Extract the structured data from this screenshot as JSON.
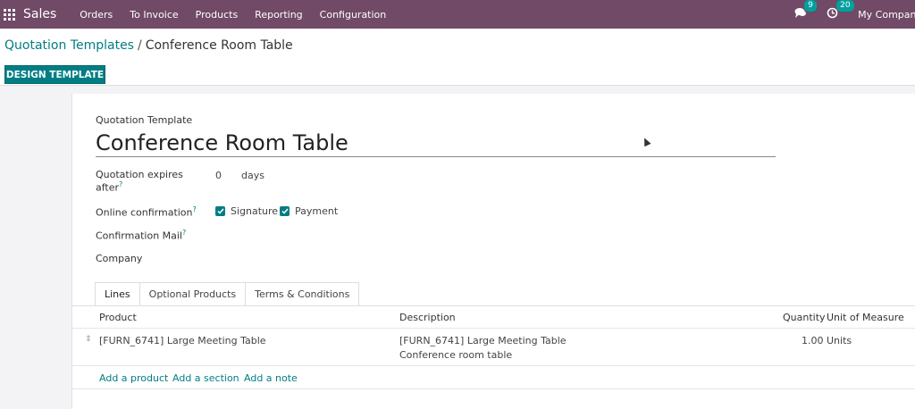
{
  "navbar": {
    "app_name": "Sales",
    "menu": [
      "Orders",
      "To Invoice",
      "Products",
      "Reporting",
      "Configuration"
    ],
    "messages_count": "9",
    "activities_count": "20",
    "company": "My Company"
  },
  "breadcrumb": {
    "parent": "Quotation Templates",
    "separator": "/",
    "current": "Conference Room Table"
  },
  "actions": {
    "design_template": "DESIGN TEMPLATE"
  },
  "form": {
    "section_label": "Quotation Template",
    "name": "Conference Room Table",
    "expires_label_line1": "Quotation expires",
    "expires_label_line2": "after",
    "expires_value": "0",
    "expires_unit": "days",
    "online_confirmation_label": "Online confirmation",
    "signature_label": "Signature",
    "payment_label": "Payment",
    "confirmation_mail_label": "Confirmation Mail",
    "company_label": "Company",
    "help_mark": "?"
  },
  "tabs": [
    "Lines",
    "Optional Products",
    "Terms & Conditions"
  ],
  "table": {
    "headers": {
      "product": "Product",
      "description": "Description",
      "quantity": "Quantity",
      "uom": "Unit of Measure"
    },
    "rows": [
      {
        "product": "[FURN_6741] Large Meeting Table",
        "description_line1": "[FURN_6741] Large Meeting Table",
        "description_line2": "Conference room table",
        "quantity": "1.00",
        "uom": "Units"
      }
    ],
    "add_product": "Add a product",
    "add_section": "Add a section",
    "add_note": "Add a note"
  },
  "colors": {
    "navbar": "#704a66",
    "accent": "#017e84"
  }
}
